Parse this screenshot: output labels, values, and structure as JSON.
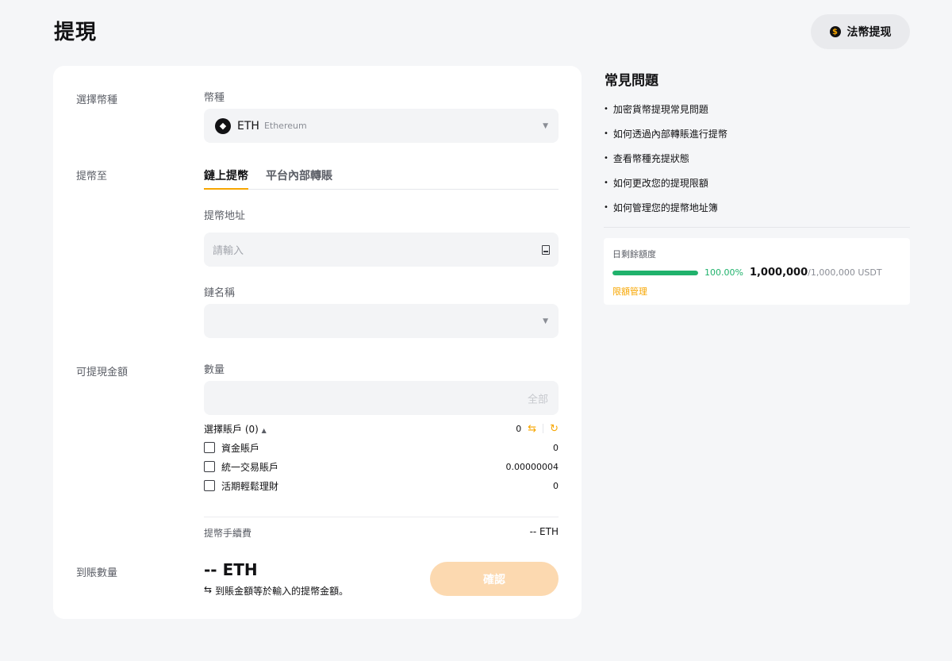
{
  "page": {
    "title": "提現"
  },
  "header": {
    "fiat_withdraw_label": "法幣提现"
  },
  "form": {
    "sections": {
      "select_coin": "選擇幣種",
      "withdraw_to": "提幣至",
      "available_amount": "可提現金額",
      "receive_amount": "到賬數量"
    },
    "coin": {
      "label": "幣種",
      "symbol": "ETH",
      "name": "Ethereum",
      "icon": "ethereum-icon"
    },
    "tabs": [
      {
        "label": "鏈上提幣",
        "active": true
      },
      {
        "label": "平台內部轉賬",
        "active": false
      }
    ],
    "address": {
      "label": "提幣地址",
      "placeholder": "請輸入"
    },
    "chain": {
      "label": "鏈名稱",
      "value": ""
    },
    "quantity": {
      "label": "數量",
      "all_label": "全部"
    },
    "accounts": {
      "toggle_label": "選擇賬戶 (0)",
      "total": "0",
      "items": [
        {
          "name": "資金賬戶",
          "value": "0",
          "checked": false
        },
        {
          "name": "統一交易賬戶",
          "value": "0.00000004",
          "checked": false
        },
        {
          "name": "活期輕鬆理財",
          "value": "0",
          "checked": false
        }
      ]
    },
    "fee": {
      "label": "提幣手續費",
      "value": "-- ETH"
    },
    "receive": {
      "amount": "-- ETH",
      "note": "到賬金額等於輸入的提幣金額。"
    },
    "confirm_label": "確認"
  },
  "faq": {
    "title": "常見問題",
    "items": [
      "加密貨幣提現常見問題",
      "如何透過內部轉賬進行提幣",
      "查看幣種充提狀態",
      "如何更改您的提現限額",
      "如何管理您的提幣地址簿"
    ]
  },
  "limit": {
    "label": "日剩餘額度",
    "percent": "100.00%",
    "fraction": 1.0,
    "current": "1,000,000",
    "total": "/1,000,000 USDT",
    "manage_label": "限額管理"
  },
  "colors": {
    "accent": "#f7a600",
    "success": "#20b26c",
    "confirm_disabled": "#fcd9b0"
  }
}
